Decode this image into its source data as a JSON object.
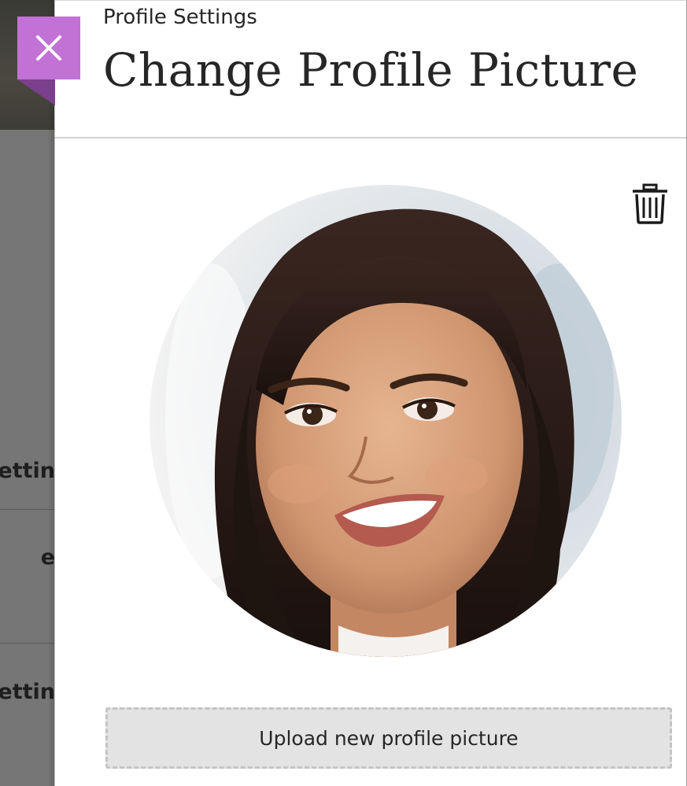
{
  "background_page": {
    "items": [
      {
        "label": "ettin"
      },
      {
        "label": "e"
      },
      {
        "label": "ettin"
      }
    ]
  },
  "panel": {
    "breadcrumb": "Profile Settings",
    "title": "Change Profile Picture",
    "close_icon": "close-icon",
    "trash_icon": "trash-icon",
    "upload_label": "Upload new profile picture"
  },
  "colors": {
    "accent": "#c271d5",
    "accent_dark": "#7b3f8b",
    "upload_bg": "#e3e3e3",
    "text": "#262626"
  }
}
